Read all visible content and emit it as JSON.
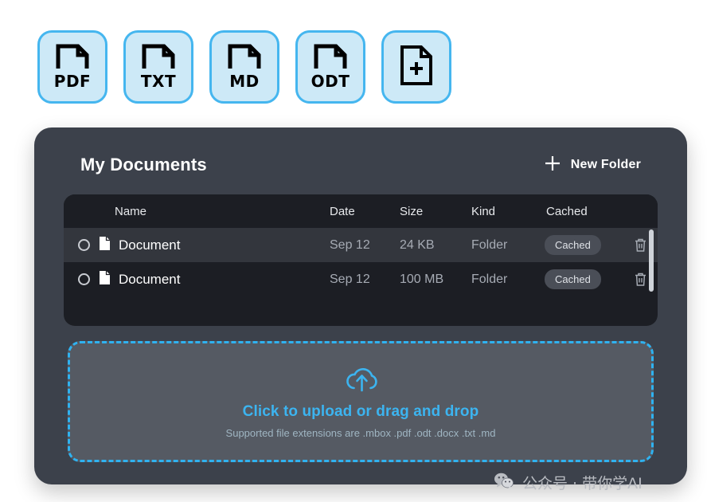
{
  "filetypes": [
    {
      "label": "PDF",
      "icon": "document-corner-icon"
    },
    {
      "label": "TXT",
      "icon": "document-corner-icon"
    },
    {
      "label": "MD",
      "icon": "document-corner-icon"
    },
    {
      "label": "ODT",
      "icon": "document-corner-icon"
    },
    {
      "label": "",
      "icon": "document-plus-icon"
    }
  ],
  "panel": {
    "title": "My Documents",
    "new_folder_label": "New Folder"
  },
  "table": {
    "headers": [
      "Name",
      "Date",
      "Size",
      "Kind",
      "Cached"
    ],
    "rows": [
      {
        "name": "Document",
        "date": "Sep 12",
        "size": "24 KB",
        "kind": "Folder",
        "cached": "Cached"
      },
      {
        "name": "Document",
        "date": "Sep 12",
        "size": "100 MB",
        "kind": "Folder",
        "cached": "Cached"
      }
    ]
  },
  "dropzone": {
    "title": "Click to upload or drag and drop",
    "subtitle": "Supported file extensions are .mbox .pdf .odt .docx .txt .md",
    "icon": "cloud-upload-icon"
  },
  "watermark": {
    "text": "公众号 · 带你学AI",
    "icon": "wechat-icon"
  },
  "colors": {
    "accent_blue": "#2fb2f0",
    "chip_fill": "#cde9f7",
    "panel_bg": "#3c414b",
    "table_bg": "#1c1e24",
    "row_hover": "#33363d",
    "dropzone_bg": "#555a63"
  }
}
